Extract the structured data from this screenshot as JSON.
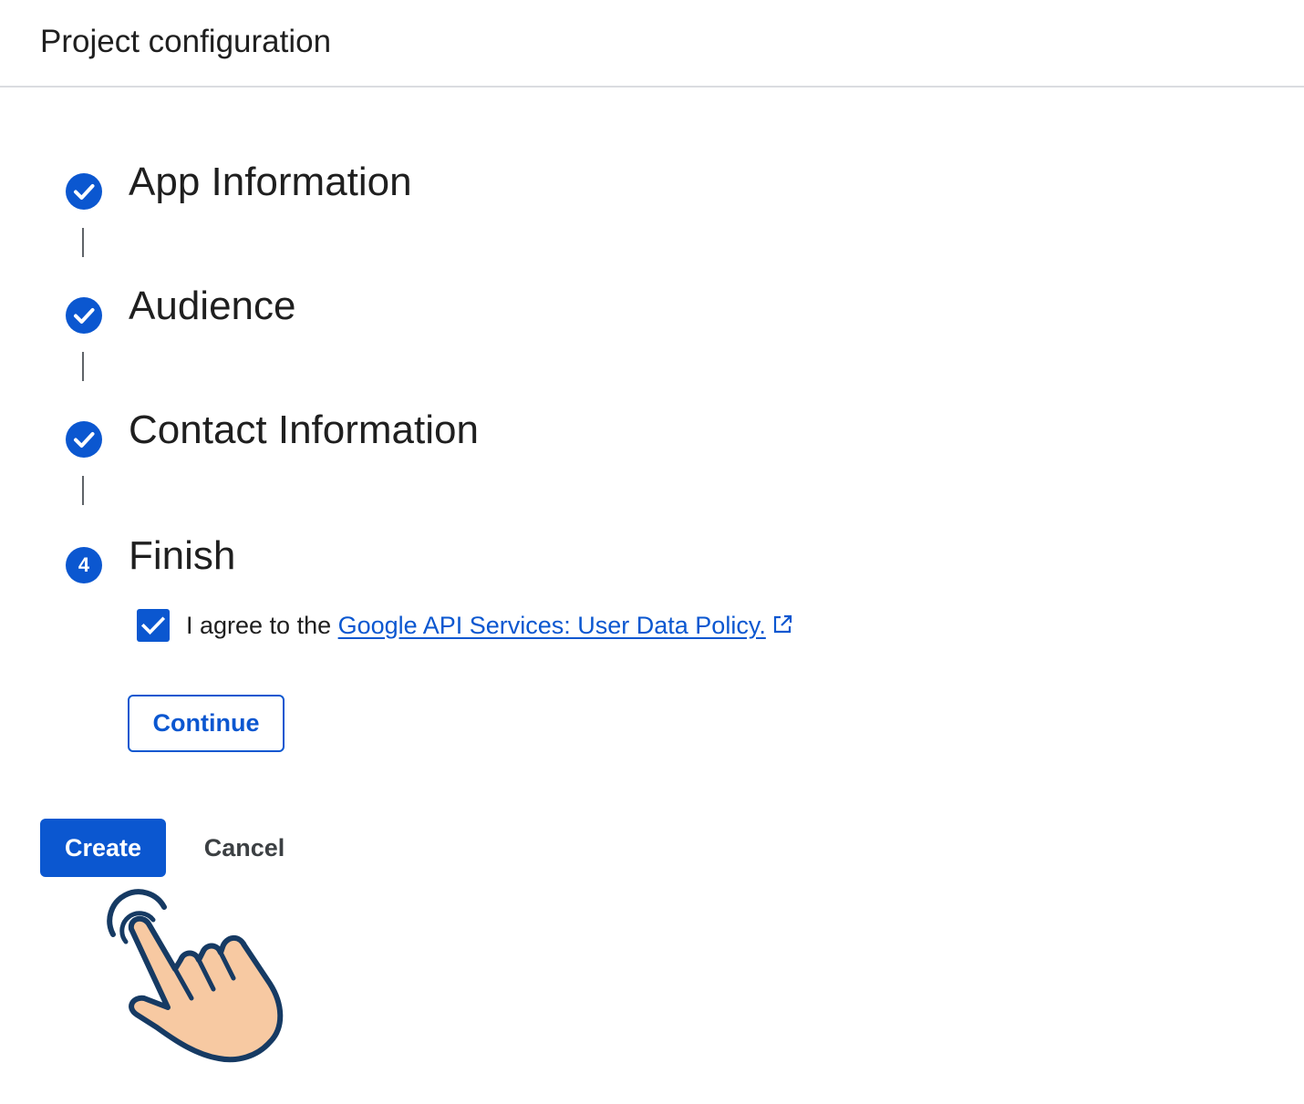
{
  "header": {
    "title": "Project configuration"
  },
  "steps": [
    {
      "label": "App Information",
      "status": "completed",
      "icon": "check-icon"
    },
    {
      "label": "Audience",
      "status": "completed",
      "icon": "check-icon"
    },
    {
      "label": "Contact Information",
      "status": "completed",
      "icon": "check-icon"
    },
    {
      "label": "Finish",
      "status": "current",
      "number": "4"
    }
  ],
  "finish": {
    "agree_prefix": "I agree to the ",
    "policy_link": "Google API Services: User Data Policy.",
    "agree_checked": true,
    "continue_label": "Continue"
  },
  "actions": {
    "create_label": "Create",
    "cancel_label": "Cancel"
  },
  "colors": {
    "accent": "#0b57d0",
    "text": "#1f1f1f",
    "divider": "#dadce0",
    "hand_fill": "#f7c9a2",
    "hand_outline": "#163a63"
  },
  "icons": {
    "pointer": "tap-hand-icon",
    "external": "open-in-new-icon"
  }
}
